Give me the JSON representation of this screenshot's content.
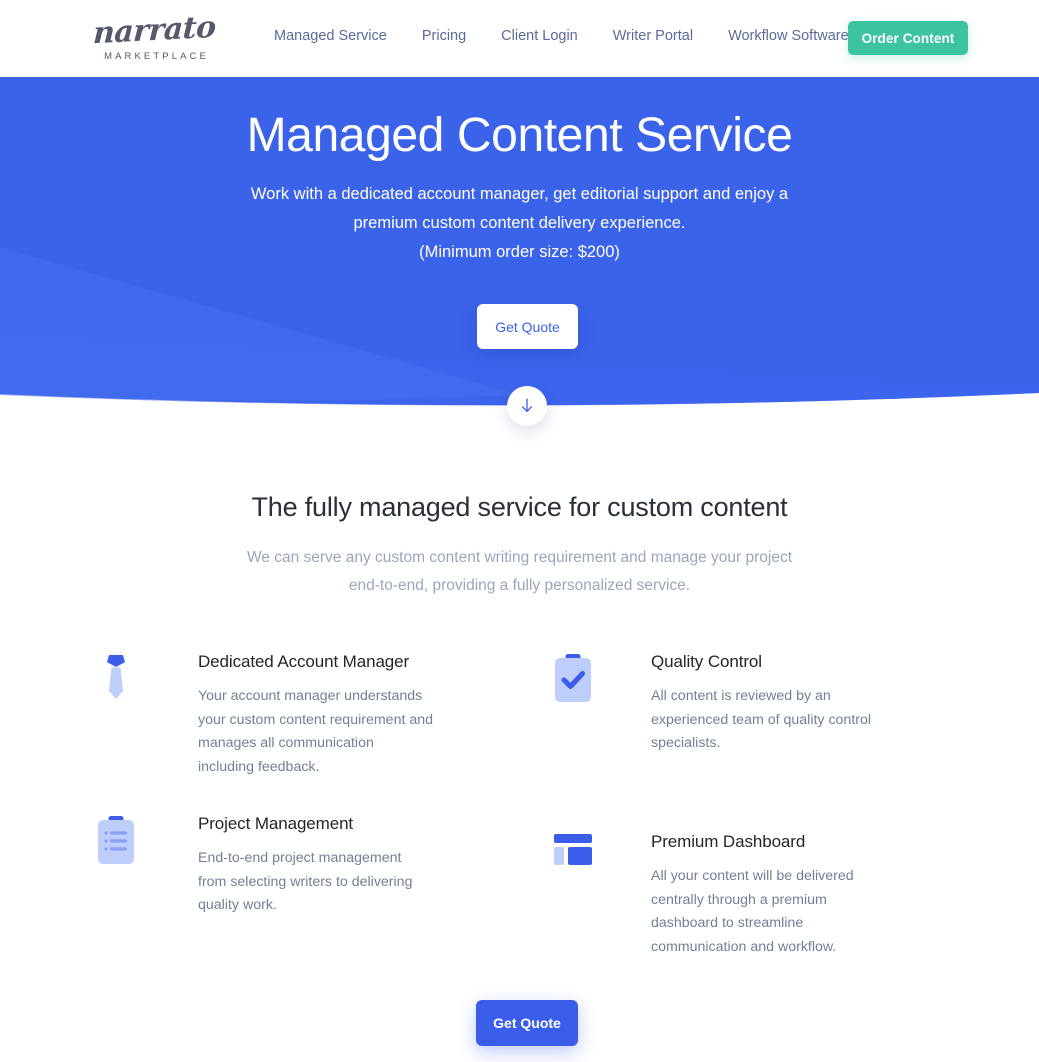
{
  "brand": {
    "logo_word": "narrato",
    "logo_sub": "MARKETPLACE",
    "accent_blue": "#3b5eea",
    "hero_blue": "#3b63ea",
    "accent_green": "#3cc4a0",
    "muted_text": "#9aa6bd",
    "nav_link_color": "#5c6a9a"
  },
  "nav": {
    "links": [
      {
        "label": "Managed Service"
      },
      {
        "label": "Pricing"
      },
      {
        "label": "Client Login"
      },
      {
        "label": "Writer Portal"
      },
      {
        "label": "Workflow Software"
      }
    ],
    "cta_label": "Order Content"
  },
  "hero": {
    "title": "Managed Content Service",
    "subtitle_line1": "Work with a dedicated account manager, get editorial support and enjoy a",
    "subtitle_line2": "premium custom content delivery experience.",
    "minimum_order": "(Minimum order size: $200)",
    "cta_label": "Get Quote",
    "scroll_icon": "arrow-down-icon"
  },
  "section": {
    "title": "The fully managed service for custom content",
    "subtitle_line1": "We can serve any custom content writing requirement and manage your project",
    "subtitle_line2": "end-to-end, providing a fully personalized service.",
    "features": [
      {
        "icon": "necktie-icon",
        "title": "Dedicated Account Manager",
        "description": "Your account manager understands your custom content requirement and manages all communication including feedback."
      },
      {
        "icon": "clipboard-check-icon",
        "title": "Quality Control",
        "description": "All content is reviewed by an experienced team of quality control specialists."
      },
      {
        "icon": "clipboard-list-icon",
        "title": "Project Management",
        "description": "End-to-end project management from selecting writers to delivering quality work."
      },
      {
        "icon": "dashboard-layout-icon",
        "title": "Premium Dashboard",
        "description": "All your content will be delivered centrally through a premium dashboard to streamline communication and workflow."
      }
    ],
    "cta_label": "Get Quote"
  }
}
